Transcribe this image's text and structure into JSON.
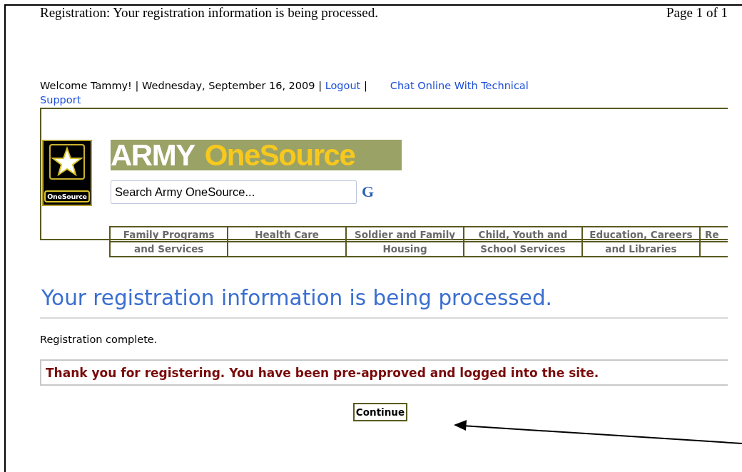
{
  "print_header": {
    "title": "Registration: Your registration information is being processed.",
    "page": "Page 1 of 1"
  },
  "top_bar": {
    "welcome": "Welcome Tammy! | Wednesday, September 16, 2009 |",
    "logout": "Logout",
    "separator": "|",
    "chat_link_lines": [
      "Chat Online With Technical",
      "Support"
    ]
  },
  "header": {
    "logo_badge": "OneSource",
    "banner": {
      "word_1": "ARMY",
      "word_2": "OneSource"
    },
    "search": {
      "placeholder": "Search Army OneSource..."
    },
    "search_button": "G"
  },
  "menu": [
    {
      "lines": [
        "Family Programs",
        "and Services"
      ]
    },
    {
      "lines": [
        "Health Care"
      ]
    },
    {
      "lines": [
        "Soldier and Family",
        "Housing"
      ]
    },
    {
      "lines": [
        "Child, Youth and",
        "School Services"
      ]
    },
    {
      "lines": [
        "Education, Careers",
        "and Libraries"
      ]
    },
    {
      "lines": [
        "Re"
      ]
    }
  ],
  "main": {
    "heading": "Your registration information is being processed.",
    "status": "Registration complete.",
    "message": "Thank you for registering. You have been pre-approved and logged into the site.",
    "button": "Continue"
  }
}
